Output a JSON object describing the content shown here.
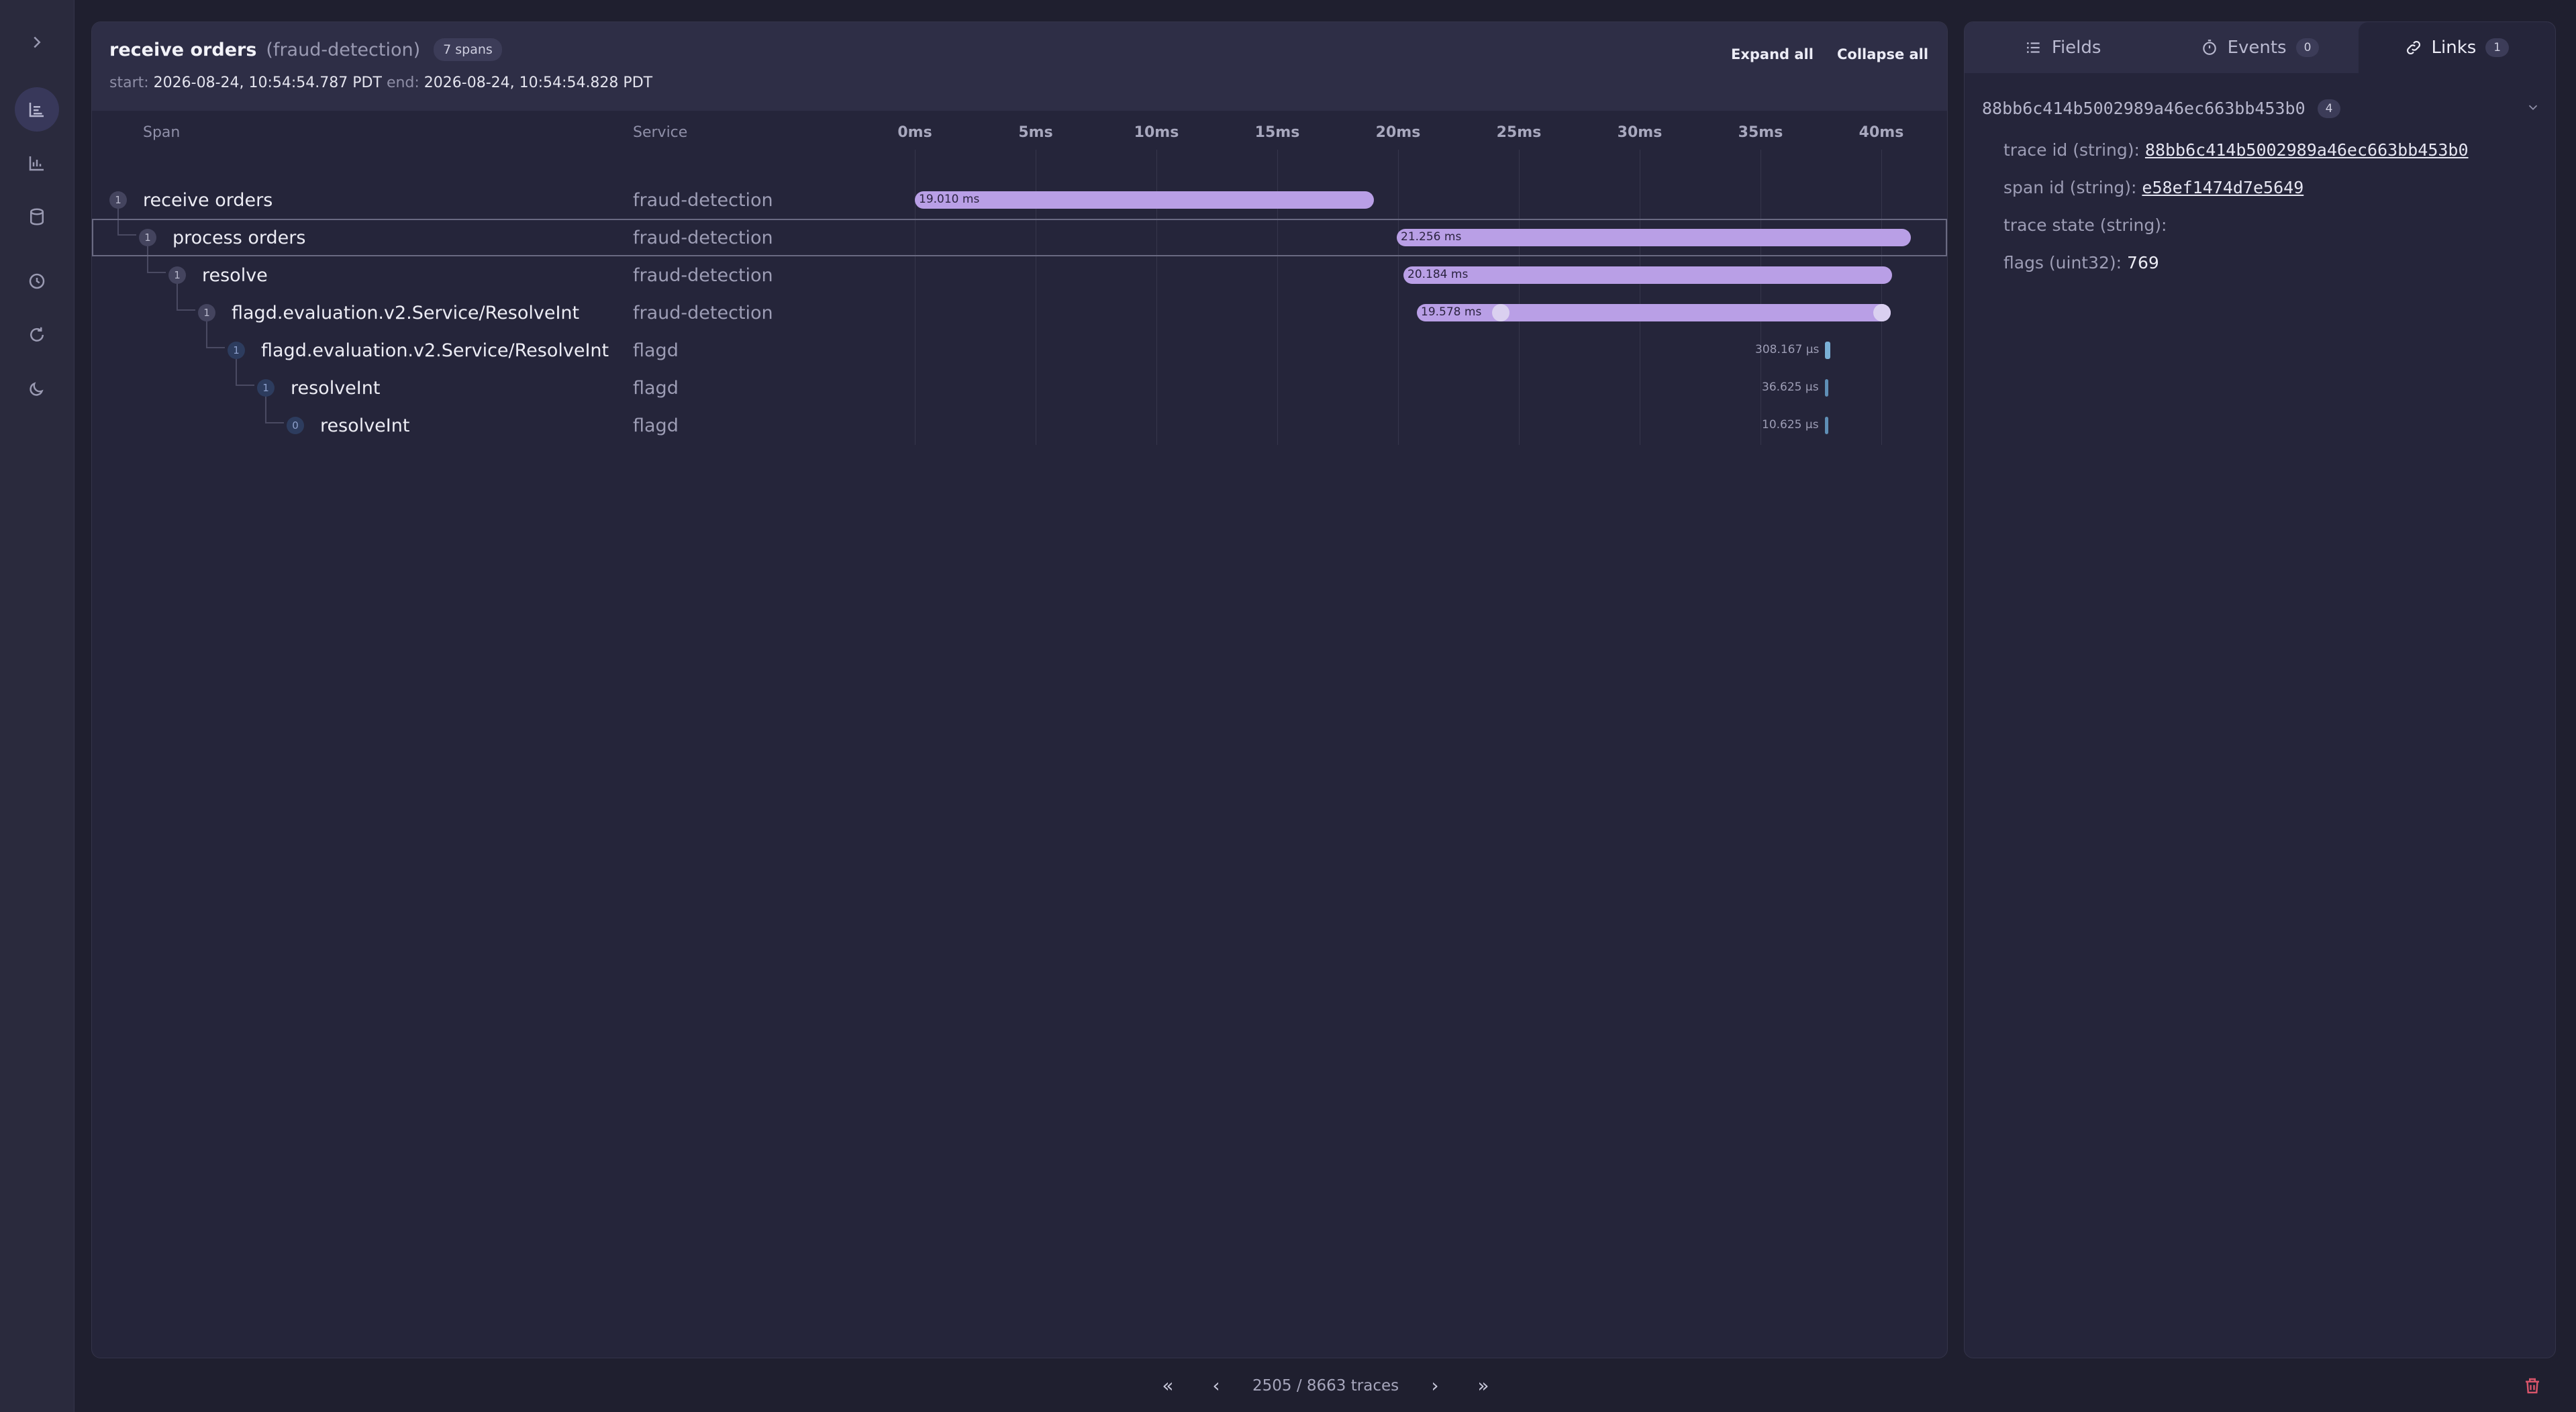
{
  "trace": {
    "title": "receive orders",
    "service": "(fraud-detection)",
    "span_count": "7 spans",
    "start_label": "start:",
    "start_value": "2026-08-24, 10:54:54.787 PDT",
    "end_label": "end:",
    "end_value": "2026-08-24, 10:54:54.828 PDT",
    "expand_all": "Expand all",
    "collapse_all": "Collapse all"
  },
  "columns": {
    "span": "Span",
    "service": "Service"
  },
  "timeline": {
    "ticks": [
      "0ms",
      "5ms",
      "10ms",
      "15ms",
      "20ms",
      "25ms",
      "30ms",
      "35ms",
      "40ms"
    ]
  },
  "spans": [
    {
      "num": "1",
      "name": "receive orders",
      "service": "fraud-detection",
      "duration": "19.010 ms"
    },
    {
      "num": "1",
      "name": "process orders",
      "service": "fraud-detection",
      "duration": "21.256 ms"
    },
    {
      "num": "1",
      "name": "resolve",
      "service": "fraud-detection",
      "duration": "20.184 ms"
    },
    {
      "num": "1",
      "name": "flagd.evaluation.v2.Service/ResolveInt",
      "service": "fraud-detection",
      "duration": "19.578 ms"
    },
    {
      "num": "1",
      "name": "flagd.evaluation.v2.Service/ResolveInt",
      "service": "flagd",
      "duration": "308.167 µs"
    },
    {
      "num": "1",
      "name": "resolveInt",
      "service": "flagd",
      "duration": "36.625 µs"
    },
    {
      "num": "0",
      "name": "resolveInt",
      "service": "flagd",
      "duration": "10.625 µs"
    }
  ],
  "pager": {
    "text": "2505 / 8663 traces"
  },
  "side": {
    "tabs": [
      {
        "label": "Fields",
        "badge": ""
      },
      {
        "label": "Events",
        "badge": "0"
      },
      {
        "label": "Links",
        "badge": "1"
      }
    ],
    "link_trace_id": "88bb6c414b5002989a46ec663bb453b0",
    "link_badge": "4",
    "attrs": [
      {
        "key": "trace id (string):",
        "value": "88bb6c414b5002989a46ec663bb453b0"
      },
      {
        "key": "span id (string):",
        "value": "e58ef1474d7e5649"
      },
      {
        "key": "trace state (string):",
        "value": ""
      },
      {
        "key": "flags (uint32):",
        "value": "769"
      }
    ]
  },
  "colors": {
    "bar": "#b99fe6",
    "micro_bar": "#5f8fb6",
    "background": "#1f1f2f"
  }
}
